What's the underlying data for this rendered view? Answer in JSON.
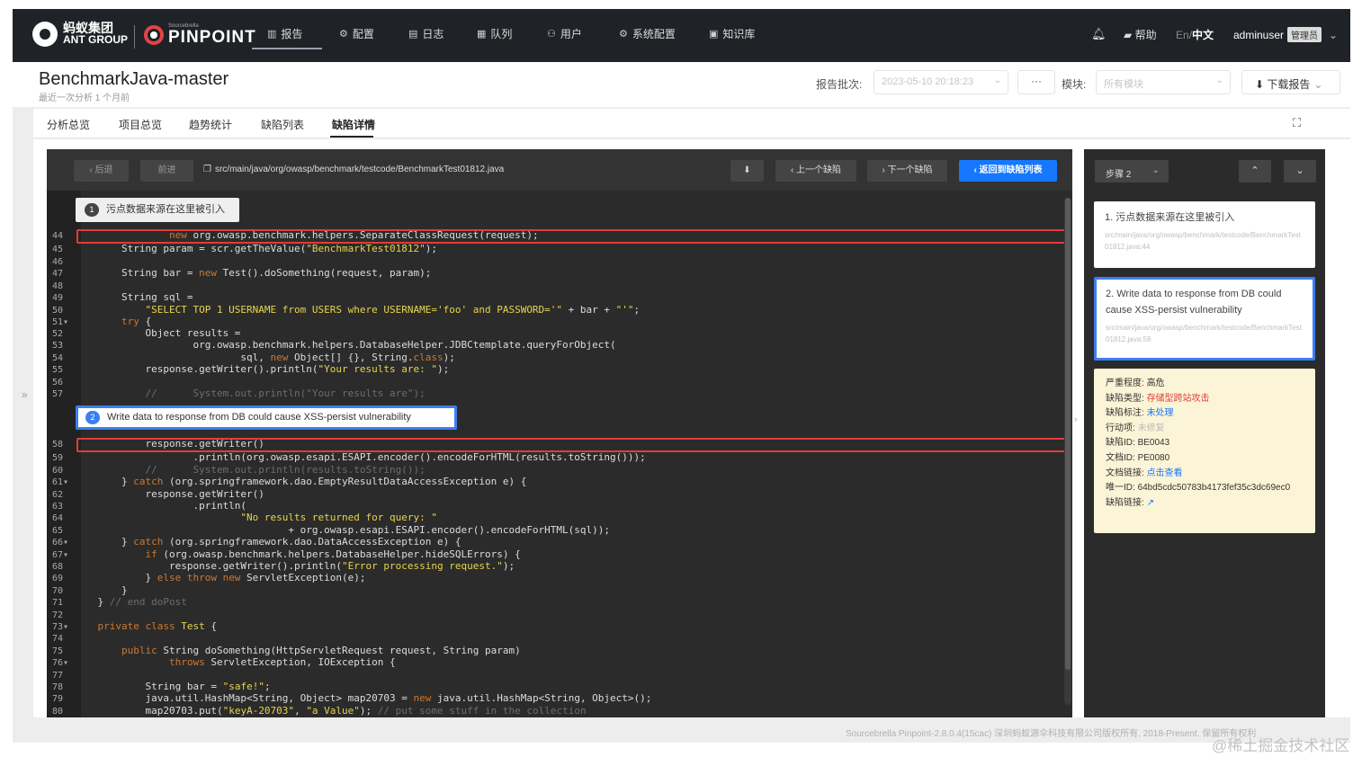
{
  "brand": {
    "ant_line1": "蚂蚁集团",
    "ant_line2": "ANT GROUP",
    "pinpoint_sub": "Sourcebrella",
    "pinpoint_main": "PINPOINT"
  },
  "nav": {
    "items": [
      {
        "icon": "bar-chart-icon",
        "glyph": "▥",
        "label": "报告"
      },
      {
        "icon": "settings-icon",
        "glyph": "⚙",
        "label": "配置"
      },
      {
        "icon": "file-icon",
        "glyph": "▤",
        "label": "日志"
      },
      {
        "icon": "list-icon",
        "glyph": "▦",
        "label": "队列"
      },
      {
        "icon": "users-icon",
        "glyph": "⚇",
        "label": "用户"
      },
      {
        "icon": "system-icon",
        "glyph": "⚙",
        "label": "系统配置"
      },
      {
        "icon": "book-icon",
        "glyph": "▣",
        "label": "知识库"
      }
    ],
    "help": "帮助",
    "lang_en": "En",
    "lang_sep": "/",
    "lang_zh": "中文",
    "username": "adminuser",
    "role": "管理员"
  },
  "header": {
    "title": "BenchmarkJava-master",
    "subtitle": "最近一次分析 1 个月前",
    "batch_label": "报告批次:",
    "batch_value": "2023-05-10 20:18:23",
    "more": "···",
    "module_label": "模块:",
    "module_value": "所有模块",
    "download": "下载报告"
  },
  "tabs": [
    "分析总览",
    "项目总览",
    "趋势统计",
    "缺陷列表",
    "缺陷详情"
  ],
  "toolbar": {
    "prev_disabled": "‹ 后退",
    "next_disabled": "前进",
    "file_path": "src/main/java/org/owasp/benchmark/testcode/BenchmarkTest01812.java",
    "pin": "⬇",
    "prev_defect": "‹ 上一个缺陷",
    "next_defect": "› 下一个缺陷",
    "back_list": "‹ 返回到缺陷列表"
  },
  "annotations": [
    {
      "num": "1",
      "text": "污点数据来源在这里被引入"
    },
    {
      "num": "2",
      "text": "Write data to response from DB could cause XSS-persist vulnerability"
    }
  ],
  "code": [
    {
      "n": "44",
      "segs": [
        {
          "t": "                new ",
          "c": "kw"
        },
        {
          "t": "org.owasp.benchmark.helpers.SeparateClassRequest(request);",
          "c": "tx"
        }
      ]
    },
    {
      "n": "45",
      "segs": [
        {
          "t": "        String param = scr.getTheValue(",
          "c": "tx"
        },
        {
          "t": "\"BenchmarkTest01812\"",
          "c": "st"
        },
        {
          "t": ");",
          "c": "tx"
        }
      ]
    },
    {
      "n": "46",
      "segs": []
    },
    {
      "n": "47",
      "segs": [
        {
          "t": "        String bar = ",
          "c": "tx"
        },
        {
          "t": "new",
          "c": "kw"
        },
        {
          "t": " Test().doSomething(request, param);",
          "c": "tx"
        }
      ]
    },
    {
      "n": "48",
      "segs": []
    },
    {
      "n": "49",
      "segs": [
        {
          "t": "        String sql =",
          "c": "tx"
        }
      ]
    },
    {
      "n": "50",
      "segs": [
        {
          "t": "            \"SELECT TOP 1 USERNAME from USERS where USERNAME='foo' and PASSWORD='\"",
          "c": "st"
        },
        {
          "t": " + bar + ",
          "c": "tx"
        },
        {
          "t": "\"'\"",
          "c": "st"
        },
        {
          "t": ";",
          "c": "tx"
        }
      ]
    },
    {
      "n": "51",
      "segs": [
        {
          "t": "        try",
          "c": "kw"
        },
        {
          "t": " {",
          "c": "tx"
        }
      ]
    },
    {
      "n": "52",
      "segs": [
        {
          "t": "            Object results =",
          "c": "tx"
        }
      ]
    },
    {
      "n": "53",
      "segs": [
        {
          "t": "                    org.owasp.benchmark.helpers.DatabaseHelper.JDBCtemplate.queryForObject(",
          "c": "tx"
        }
      ]
    },
    {
      "n": "54",
      "segs": [
        {
          "t": "                            sql, ",
          "c": "tx"
        },
        {
          "t": "new",
          "c": "kw"
        },
        {
          "t": " Object[] {}, String.",
          "c": "tx"
        },
        {
          "t": "class",
          "c": "kw"
        },
        {
          "t": ");",
          "c": "tx"
        }
      ]
    },
    {
      "n": "55",
      "segs": [
        {
          "t": "            response.getWriter().println(",
          "c": "tx"
        },
        {
          "t": "\"Your results are: \"",
          "c": "st"
        },
        {
          "t": ");",
          "c": "tx"
        }
      ]
    },
    {
      "n": "56",
      "segs": []
    },
    {
      "n": "57",
      "segs": [
        {
          "t": "            //      System.out.println(\"Your results are\");",
          "c": "cm"
        }
      ]
    },
    {
      "n": "58",
      "segs": [
        {
          "t": "            response.getWriter()",
          "c": "tx"
        }
      ]
    },
    {
      "n": "59",
      "segs": [
        {
          "t": "                    .println(org.owasp.esapi.ESAPI.encoder().encodeForHTML(results.toString()));",
          "c": "tx"
        }
      ]
    },
    {
      "n": "60",
      "segs": [
        {
          "t": "            //      System.out.println(results.toString());",
          "c": "cm"
        }
      ]
    },
    {
      "n": "61",
      "segs": [
        {
          "t": "        } ",
          "c": "tx"
        },
        {
          "t": "catch",
          "c": "kw"
        },
        {
          "t": " (org.springframework.dao.EmptyResultDataAccessException e) {",
          "c": "tx"
        }
      ]
    },
    {
      "n": "62",
      "segs": [
        {
          "t": "            response.getWriter()",
          "c": "tx"
        }
      ]
    },
    {
      "n": "63",
      "segs": [
        {
          "t": "                    .println(",
          "c": "tx"
        }
      ]
    },
    {
      "n": "64",
      "segs": [
        {
          "t": "                            \"No results returned for query: \"",
          "c": "st"
        }
      ]
    },
    {
      "n": "65",
      "segs": [
        {
          "t": "                                    + org.owasp.esapi.ESAPI.encoder().encodeForHTML(sql));",
          "c": "tx"
        }
      ]
    },
    {
      "n": "66",
      "segs": [
        {
          "t": "        } ",
          "c": "tx"
        },
        {
          "t": "catch",
          "c": "kw"
        },
        {
          "t": " (org.springframework.dao.DataAccessException e) {",
          "c": "tx"
        }
      ]
    },
    {
      "n": "67",
      "segs": [
        {
          "t": "            ",
          "c": "tx"
        },
        {
          "t": "if",
          "c": "kw"
        },
        {
          "t": " (org.owasp.benchmark.helpers.DatabaseHelper.hideSQLErrors) {",
          "c": "tx"
        }
      ]
    },
    {
      "n": "68",
      "segs": [
        {
          "t": "                response.getWriter().println(",
          "c": "tx"
        },
        {
          "t": "\"Error processing request.\"",
          "c": "st"
        },
        {
          "t": ");",
          "c": "tx"
        }
      ]
    },
    {
      "n": "69",
      "segs": [
        {
          "t": "            } ",
          "c": "tx"
        },
        {
          "t": "else throw new",
          "c": "kw"
        },
        {
          "t": " ServletException(e);",
          "c": "tx"
        }
      ]
    },
    {
      "n": "70",
      "segs": [
        {
          "t": "        }",
          "c": "tx"
        }
      ]
    },
    {
      "n": "71",
      "segs": [
        {
          "t": "    } ",
          "c": "tx"
        },
        {
          "t": "// end doPost",
          "c": "cm"
        }
      ]
    },
    {
      "n": "72",
      "segs": []
    },
    {
      "n": "73",
      "segs": [
        {
          "t": "    private class ",
          "c": "kw"
        },
        {
          "t": "Test",
          "c": "cl"
        },
        {
          "t": " {",
          "c": "tx"
        }
      ]
    },
    {
      "n": "74",
      "segs": []
    },
    {
      "n": "75",
      "segs": [
        {
          "t": "        public ",
          "c": "kw"
        },
        {
          "t": "String doSomething(HttpServletRequest request, String param)",
          "c": "tx"
        }
      ]
    },
    {
      "n": "76",
      "segs": [
        {
          "t": "                throws",
          "c": "kw"
        },
        {
          "t": " ServletException, IOException {",
          "c": "tx"
        }
      ]
    },
    {
      "n": "77",
      "segs": []
    },
    {
      "n": "78",
      "segs": [
        {
          "t": "            String bar = ",
          "c": "tx"
        },
        {
          "t": "\"safe!\"",
          "c": "st"
        },
        {
          "t": ";",
          "c": "tx"
        }
      ]
    },
    {
      "n": "79",
      "segs": [
        {
          "t": "            java.util.HashMap<String, Object> map20703 = ",
          "c": "tx"
        },
        {
          "t": "new",
          "c": "kw"
        },
        {
          "t": " java.util.HashMap<String, Object>();",
          "c": "tx"
        }
      ]
    },
    {
      "n": "80",
      "segs": [
        {
          "t": "            map20703.put(",
          "c": "tx"
        },
        {
          "t": "\"keyA-20703\"",
          "c": "st"
        },
        {
          "t": ", ",
          "c": "tx"
        },
        {
          "t": "\"a Value\"",
          "c": "st"
        },
        {
          "t": "); ",
          "c": "tx"
        },
        {
          "t": "// put some stuff in the collection",
          "c": "cm"
        }
      ]
    }
  ],
  "colors": {
    "kw": "#cc7832",
    "st": "#e8d44d",
    "tx": "#dddddd",
    "cm": "#6d6d6d",
    "cl": "#e8d44d",
    "highlight": "#e33b3b",
    "accent": "#1677ff"
  },
  "steps": {
    "selector": "步骤 2",
    "up": "⌃",
    "down": "⌄",
    "cards": [
      {
        "title": "1. 污点数据来源在这里被引入",
        "path": "src/main/java/org/owasp/benchmark/testcode/BenchmarkTest01812.java:44"
      },
      {
        "title": "2. Write data to response from DB could cause XSS-persist vulnerability",
        "path": "src/main/java/org/owasp/benchmark/testcode/BenchmarkTest01812.java:58"
      }
    ]
  },
  "detail": {
    "severity_label": "严重程度:",
    "severity": "高危",
    "type_label": "缺陷类型:",
    "type": "存储型跨站攻击",
    "mark_label": "缺陷标注:",
    "mark": "未处理",
    "action_label": "行动项:",
    "action": "未修复",
    "defect_id_label": "缺陷ID:",
    "defect_id": "BE0043",
    "doc_id_label": "文档ID:",
    "doc_id": "PE0080",
    "doc_link_label": "文档链接:",
    "doc_link": "点击查看",
    "uid_label": "唯一ID:",
    "uid": "64bd5cdc50783b4173fef35c3dc69ec0",
    "defect_link_label": "缺陷链接:"
  },
  "footer": "Sourcebrella Pinpoint-2.8.0.4(15cac) 深圳蚂蚁源伞科技有限公司版权所有, 2018-Present. 保留所有权利",
  "watermark": "@稀土掘金技术社区"
}
